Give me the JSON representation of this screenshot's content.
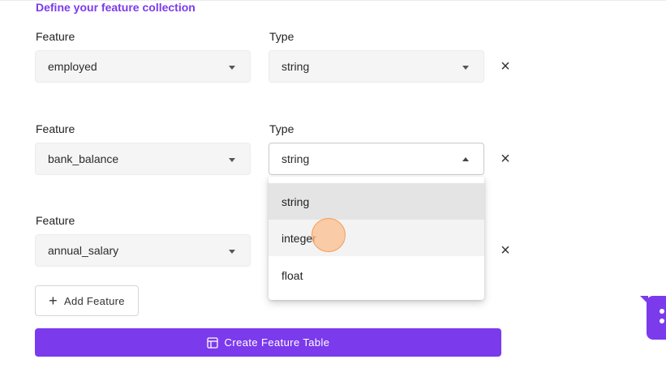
{
  "form": {
    "section_title": "Define your feature collection",
    "rows": [
      {
        "feature_label": "Feature",
        "type_label": "Type",
        "feature_value": "employed",
        "type_value": "string",
        "remove_glyph": "×"
      },
      {
        "feature_label": "Feature",
        "type_label": "Type",
        "feature_value": "bank_balance",
        "type_value": "string",
        "remove_glyph": "×"
      },
      {
        "feature_label": "Feature",
        "feature_value": "annual_salary",
        "remove_glyph": "×"
      }
    ],
    "type_dropdown": {
      "open_on_row": 2,
      "options": [
        "string",
        "integer",
        "float"
      ],
      "selected": "string",
      "hovered": "integer"
    },
    "add_feature_label": "Add Feature",
    "create_table_label": "Create Feature Table"
  },
  "icons": {
    "remove": "close-icon",
    "add": "plus-icon",
    "create": "table-icon",
    "select_caret": "chevron-down-icon",
    "fab": "chat-widget-icon"
  },
  "colors": {
    "accent": "#7c3aed",
    "select_bg": "#f5f5f5",
    "option_selected_bg": "#e4e4e4",
    "cursor_highlight": "#fbbe8c"
  }
}
